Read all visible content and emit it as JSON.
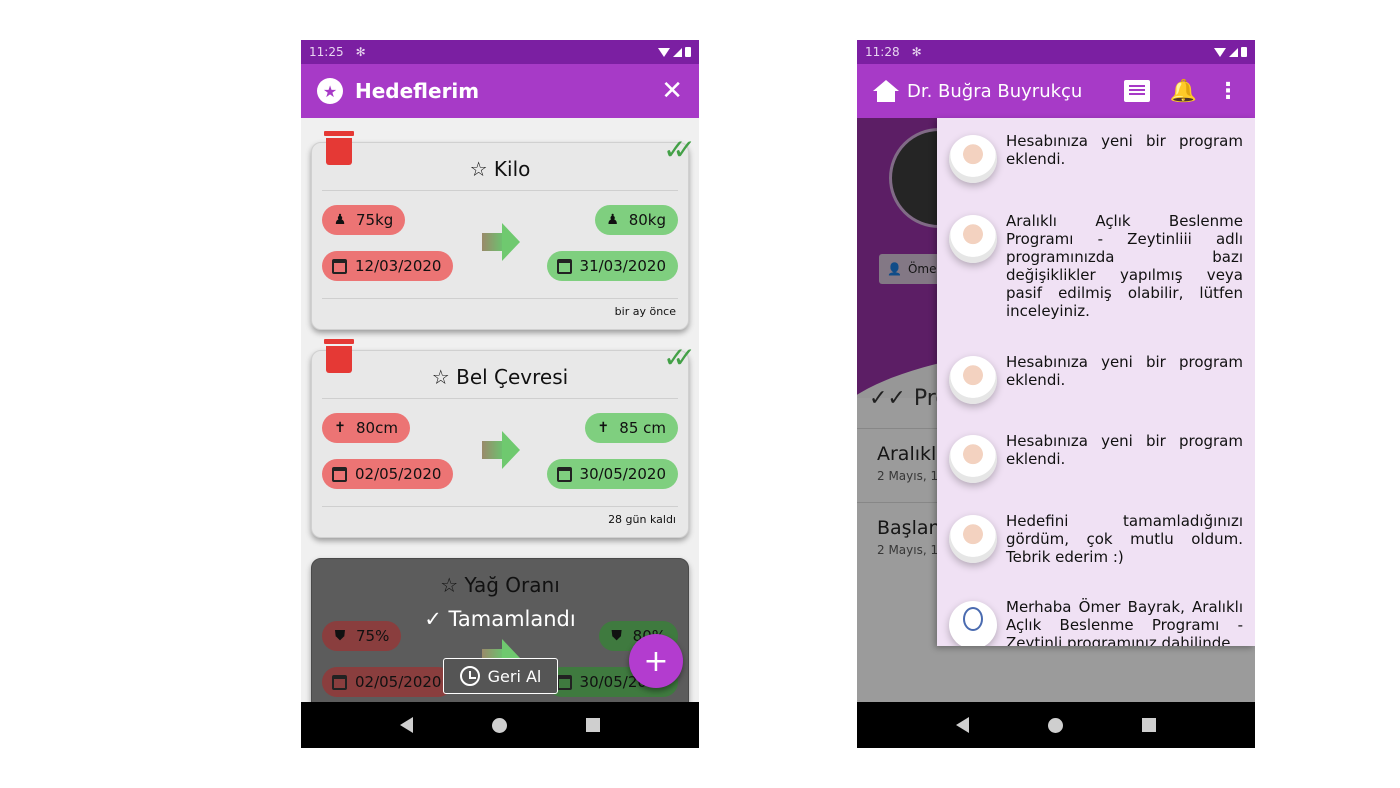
{
  "left_screen": {
    "status": {
      "time": "11:25"
    },
    "appbar": {
      "title": "Hedeflerim"
    },
    "goals": [
      {
        "title": "Kilo",
        "start_value": "75kg",
        "start_date": "12/03/2020",
        "target_value": "80kg",
        "target_date": "31/03/2020",
        "footer": "bir ay önce",
        "value_icon": "person-icon"
      },
      {
        "title": "Bel Çevresi",
        "start_value": "80cm",
        "start_date": "02/05/2020",
        "target_value": "85 cm",
        "target_date": "30/05/2020",
        "footer": "28 gün kaldı",
        "value_icon": "accessibility-icon"
      },
      {
        "title": "Yağ Oranı",
        "start_value": "75%",
        "start_date": "02/05/2020",
        "target_value": "80%",
        "target_date": "30/05/2020",
        "status": "Tamamlandı",
        "undo_label": "Geri Al",
        "value_icon": "shield-icon"
      }
    ],
    "fab_label": "+"
  },
  "right_screen": {
    "status": {
      "time": "11:28"
    },
    "appbar": {
      "title": "Dr. Buğra Buyrukçu"
    },
    "background": {
      "chip": "Ömer",
      "section": "Pro",
      "rows": [
        {
          "title": "Aralıkl",
          "subtitle": "2 Mayıs, 1"
        },
        {
          "title": "Başlan",
          "subtitle": "2 Mayıs, 1"
        }
      ]
    },
    "notifications": [
      {
        "text": "Hesabınıza yeni bir program eklendi."
      },
      {
        "text": "Aralıklı Açlık Beslenme Programı - Zeytinliii adlı programınızda bazı değişiklikler yapılmış veya pasif edilmiş olabilir, lütfen inceleyiniz."
      },
      {
        "text": "Hesabınıza yeni bir program eklendi."
      },
      {
        "text": "Hesabınıza yeni bir program eklendi."
      },
      {
        "text": "Hedefini tamamladığınızı gördüm, çok mutlu oldum. Tebrik ederim :)"
      },
      {
        "text": "Merhaba Ömer Bayrak, Aralıklı Açlık Beslenme Programı - Zeytinli programınız dahilinde"
      }
    ]
  },
  "colors": {
    "primary": "#a73ac7",
    "status_bar": "#7b1fa2",
    "start_pill": "#ec7474",
    "target_pill": "#7fcf7f",
    "delete": "#e53935",
    "complete_check": "#43a047"
  }
}
